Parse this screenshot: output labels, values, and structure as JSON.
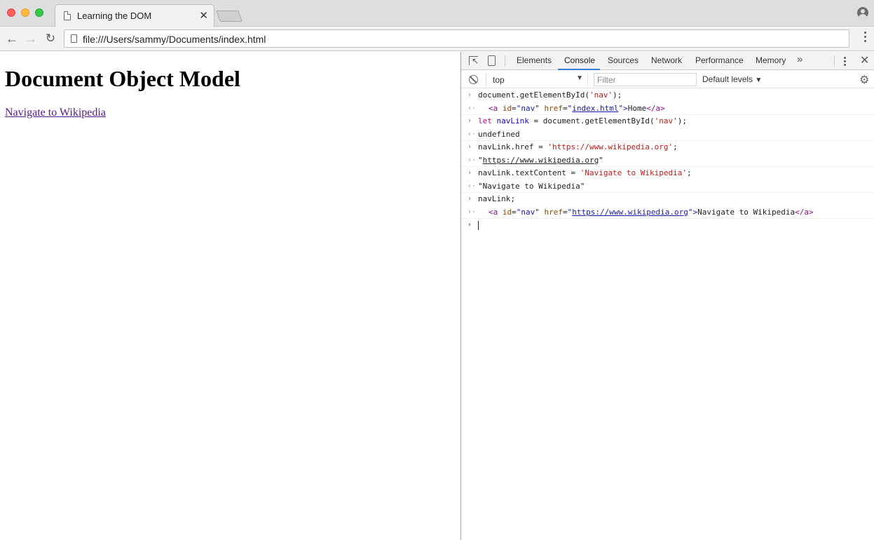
{
  "browser": {
    "tab_title": "Learning the DOM",
    "url": "file:///Users/sammy/Documents/index.html"
  },
  "page": {
    "heading": "Document Object Model",
    "link_text": "Navigate to Wikipedia"
  },
  "devtools": {
    "tabs": [
      "Elements",
      "Console",
      "Sources",
      "Network",
      "Performance",
      "Memory"
    ],
    "active_tab": "Console",
    "more_tabs": "»",
    "context": "top",
    "filter_placeholder": "Filter",
    "levels": "Default levels",
    "console": {
      "l1_input": "document.getElementById(",
      "l1_str": "'nav'",
      "l1_end": ");",
      "l1_out_tag_open": "<a",
      "l1_out_attr_id": "id",
      "l1_out_val_id": "\"nav\"",
      "l1_out_attr_href": "href",
      "l1_out_q1": "\"",
      "l1_out_href": "index.html",
      "l1_out_q2": "\">",
      "l1_out_text": "Home",
      "l1_out_tag_close": "</a>",
      "l2_kw": "let",
      "l2_var": "navLink",
      "l2_mid": " = document.getElementById(",
      "l2_str": "'nav'",
      "l2_end": ");",
      "l2_out": "undefined",
      "l3_input": "navLink.href = ",
      "l3_str": "'https://www.wikipedia.org'",
      "l3_end": ";",
      "l3_out_q1": "\"",
      "l3_out_link": "https://www.wikipedia.org",
      "l3_out_q2": "\"",
      "l4_input": "navLink.textContent = ",
      "l4_str": "'Navigate to Wikipedia'",
      "l4_end": ";",
      "l4_out": "\"Navigate to Wikipedia\"",
      "l5_input": "navLink;",
      "l5_out_tag_open": "<a",
      "l5_out_attr_id": "id",
      "l5_out_val_id": "\"nav\"",
      "l5_out_attr_href": "href",
      "l5_out_q1": "\"",
      "l5_out_href": "https://www.wikipedia.org",
      "l5_out_q2": "\">",
      "l5_out_text": "Navigate to Wikipedia",
      "l5_out_tag_close": "</a>"
    }
  },
  "icons": {
    "back": "←",
    "forward": "→",
    "reload": "↻",
    "close_tab": "✕",
    "close_devtools": "✕",
    "gear": "⚙",
    "prompt": "›",
    "result": "‹·",
    "caret": "▼"
  }
}
